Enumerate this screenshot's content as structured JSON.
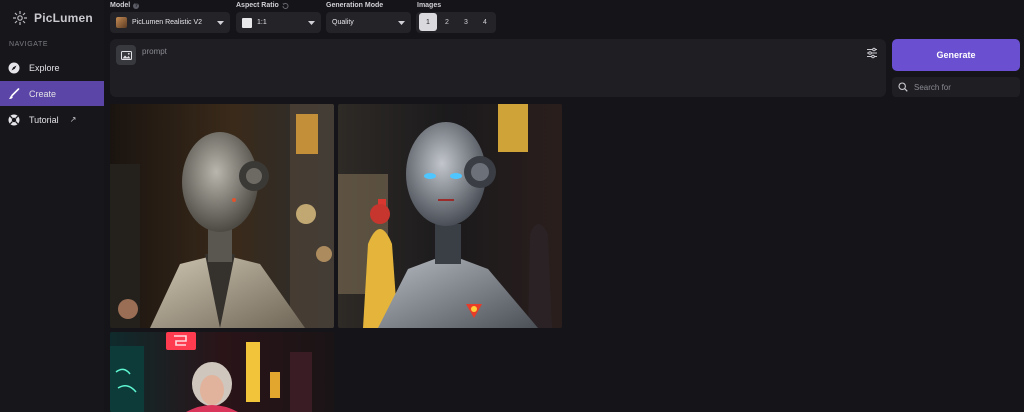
{
  "app": {
    "name": "PicLumen"
  },
  "sidebar": {
    "heading": "NAVIGATE",
    "items": [
      {
        "label": "Explore",
        "icon": "compass-icon"
      },
      {
        "label": "Create",
        "icon": "brush-icon",
        "active": true
      },
      {
        "label": "Tutorial",
        "icon": "lifebuoy-icon",
        "external": "↗"
      }
    ]
  },
  "controls": {
    "model": {
      "label": "Model",
      "value": "PicLumen Realistic V2"
    },
    "aspect_ratio": {
      "label": "Aspect Ratio",
      "value": "1:1"
    },
    "generation_mode": {
      "label": "Generation Mode",
      "value": "Quality"
    },
    "images": {
      "label": "Images",
      "options": [
        "1",
        "2",
        "3",
        "4"
      ],
      "selected": "1"
    }
  },
  "prompt": {
    "placeholder": "prompt",
    "value": ""
  },
  "generate": {
    "label": "Generate"
  },
  "search": {
    "placeholder": "Search for"
  },
  "colors": {
    "accent": "#6a4fd0",
    "active_nav": "#5b45a6",
    "background": "#151519"
  }
}
